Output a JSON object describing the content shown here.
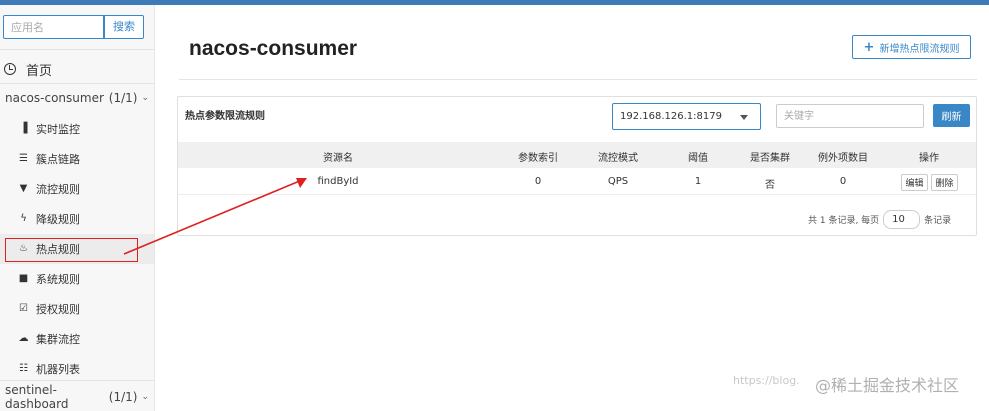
{
  "sidebar": {
    "search_placeholder": "应用名",
    "search_button": "搜索",
    "home_label": "首页",
    "apps": [
      {
        "name": "nacos-consumer",
        "count": "(1/1)"
      },
      {
        "name": "sentinel-dashboard",
        "count": "(1/1)"
      }
    ],
    "menu": [
      {
        "label": "实时监控",
        "icon": "bar-chart-icon",
        "glyph": "▐"
      },
      {
        "label": "簇点链路",
        "icon": "list-icon",
        "glyph": "☰"
      },
      {
        "label": "流控规则",
        "icon": "filter-icon",
        "glyph": "▼"
      },
      {
        "label": "降级规则",
        "icon": "flash-icon",
        "glyph": "ϟ"
      },
      {
        "label": "热点规则",
        "icon": "fire-icon",
        "glyph": "♨"
      },
      {
        "label": "系统规则",
        "icon": "lock-icon",
        "glyph": "■"
      },
      {
        "label": "授权规则",
        "icon": "check-square-icon",
        "glyph": "☑"
      },
      {
        "label": "集群流控",
        "icon": "cloud-icon",
        "glyph": "☁"
      },
      {
        "label": "机器列表",
        "icon": "th-list-icon",
        "glyph": "☷"
      }
    ]
  },
  "main": {
    "title": "nacos-consumer",
    "add_button": "新增热点限流规则",
    "panel_title": "热点参数限流规则",
    "ip_select": "192.168.126.1:8179",
    "keyword_placeholder": "关键字",
    "refresh_button": "刷新",
    "columns": [
      "资源名",
      "参数索引",
      "流控模式",
      "阈值",
      "是否集群",
      "例外项数目",
      "操作"
    ],
    "rows": [
      {
        "resource": "findById",
        "param_index": "0",
        "mode": "QPS",
        "threshold": "1",
        "cluster": "否",
        "exceptions": "0",
        "edit": "编辑",
        "delete": "删除"
      }
    ],
    "pager": {
      "prefix": "共 1 条记录, 每页",
      "page_size": "10",
      "suffix": "条记录"
    }
  },
  "watermark": {
    "url": "https://blog.",
    "brand": "@稀土掘金技术社区"
  },
  "colors": {
    "accent": "#3a87c8",
    "annotation_red": "#e02020",
    "topbar": "#3d7ab8"
  }
}
